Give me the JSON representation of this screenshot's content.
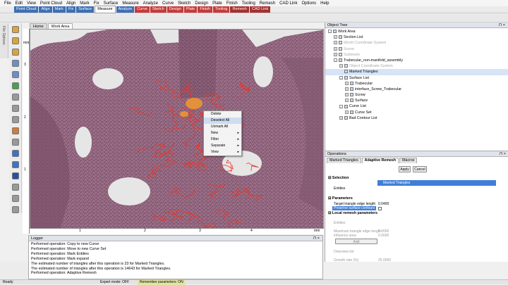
{
  "menu": [
    "File",
    "Edit",
    "View",
    "Point Cloud",
    "Align",
    "Mark",
    "Fix",
    "Surface",
    "Measure",
    "Analyze",
    "Curve",
    "Sketch",
    "Design",
    "Plate",
    "Finish",
    "Tooling",
    "Remesh",
    "CAD Link",
    "Options",
    "Help"
  ],
  "modes": [
    {
      "label": "Point Cloud",
      "style": "m-blue"
    },
    {
      "label": "Align",
      "style": "m-blue"
    },
    {
      "label": "Mark",
      "style": "m-blue"
    },
    {
      "label": "Fix",
      "style": "m-blue"
    },
    {
      "label": "Surface",
      "style": "m-blue"
    },
    {
      "label": "Measure",
      "style": "m-white"
    },
    {
      "label": "Analyze",
      "style": "m-blue"
    },
    {
      "label": "Curve",
      "style": "m-red"
    },
    {
      "label": "Sketch",
      "style": "m-red"
    },
    {
      "label": "Design",
      "style": "m-red"
    },
    {
      "label": "Plate",
      "style": "m-red"
    },
    {
      "label": "Finish",
      "style": "m-red"
    },
    {
      "label": "Tooling",
      "style": "m-red"
    },
    {
      "label": "Remesh",
      "style": "m-redd"
    },
    {
      "label": "CAD Link",
      "style": "m-redd"
    }
  ],
  "file_options_label": "File Options",
  "view_tabs": [
    {
      "label": "Home"
    },
    {
      "label": "Work Area"
    }
  ],
  "ruler": {
    "unit": "mm",
    "v_ticks": [
      "3",
      "2",
      "1"
    ],
    "h_ticks": [
      "1",
      "2",
      "3",
      "4",
      "mm"
    ]
  },
  "context_menu": [
    {
      "label": "Delete",
      "sub": false
    },
    {
      "label": "Deselect All",
      "sub": false,
      "highlight": true
    },
    {
      "label": "Unmark All",
      "sub": false
    },
    {
      "label": "New",
      "sub": true
    },
    {
      "label": "Filter",
      "sub": true
    },
    {
      "label": "Separate",
      "sub": true
    },
    {
      "label": "View",
      "sub": true
    }
  ],
  "object_tree": {
    "title": "Object Tree",
    "rows": [
      {
        "label": "Work Area",
        "indent": 0,
        "toggle": "-",
        "grey": false
      },
      {
        "label": "Section List",
        "indent": 1,
        "toggle": "+",
        "grey": false
      },
      {
        "label": "World Coordinate System",
        "indent": 1,
        "toggle": "+",
        "grey": true
      },
      {
        "label": "Scene",
        "indent": 1,
        "toggle": "+",
        "grey": true
      },
      {
        "label": "Sublevels",
        "indent": 1,
        "toggle": "+",
        "grey": true
      },
      {
        "label": "Trabecular_non-manifold_assembly",
        "indent": 1,
        "toggle": "-",
        "grey": false
      },
      {
        "label": "Object Coordinate System",
        "indent": 2,
        "toggle": "+",
        "grey": true
      },
      {
        "label": "Marked Triangles",
        "indent": 2,
        "toggle": "",
        "grey": false,
        "sel": true
      },
      {
        "label": "Surface List",
        "indent": 2,
        "toggle": "-",
        "grey": false
      },
      {
        "label": "Trabecular",
        "indent": 3,
        "toggle": "+",
        "grey": false
      },
      {
        "label": "interface_Screw_Trabecular",
        "indent": 3,
        "toggle": "+",
        "grey": false
      },
      {
        "label": "Screw",
        "indent": 3,
        "toggle": "+",
        "grey": false
      },
      {
        "label": "Surface",
        "indent": 3,
        "toggle": "+",
        "grey": false
      },
      {
        "label": "Curve List",
        "indent": 2,
        "toggle": "-",
        "grey": false
      },
      {
        "label": "Curve Set",
        "indent": 3,
        "toggle": "+",
        "grey": false
      },
      {
        "label": "Bad Contour List",
        "indent": 2,
        "toggle": "+",
        "grey": false
      }
    ]
  },
  "operations": {
    "title": "Operations",
    "tabs": [
      {
        "label": "Marked Triangles"
      },
      {
        "label": "Adaptive Remesh",
        "active": true
      },
      {
        "label": "Macros"
      }
    ],
    "apply": "Apply",
    "cancel": "Cancel",
    "selection_header": "Selection",
    "entities_label": "Entities",
    "entities_value": "Marked Triangles",
    "parameters_header": "Parameters",
    "target_label": "Target triangle edge length",
    "target_value": "0.0400",
    "preserve_label": "Preserve surface contours",
    "local_header": "Local remesh parameters",
    "local_entities": "Entities",
    "max_len_label": "Maximum triangle edge length",
    "max_len_value": "1.0000",
    "influence_label": "Influence area",
    "influence_value": "0.0000",
    "add_label": "Add",
    "overview_label": "Overview list",
    "growth_label": "Growth rate (%)",
    "growth_value": "25.0000"
  },
  "logger": {
    "title": "Logger",
    "lines": [
      "Performed operation: Copy to new Curve",
      "Performed operation: Move to new Curve Set",
      "Performed operation: Mark Entities",
      "Performed operation: Mark expand",
      "The estimated number of triangles after this operation is 23 for Marked Triangles.",
      "The estimated number of triangles after this operation is 14643 for Marked Triangles.",
      "Performed operation: Adaptive Remesh"
    ]
  },
  "status": {
    "ready": "Ready",
    "expert": "Expert mode: OFF",
    "remember": "Remember parameters: ON"
  },
  "colors": {
    "mesh": "#9c6f88",
    "mesh_dark": "#6f4a60",
    "bg_top": "#e4e4e4",
    "marked": "#e6382e",
    "accent": "#3f7fd8"
  }
}
